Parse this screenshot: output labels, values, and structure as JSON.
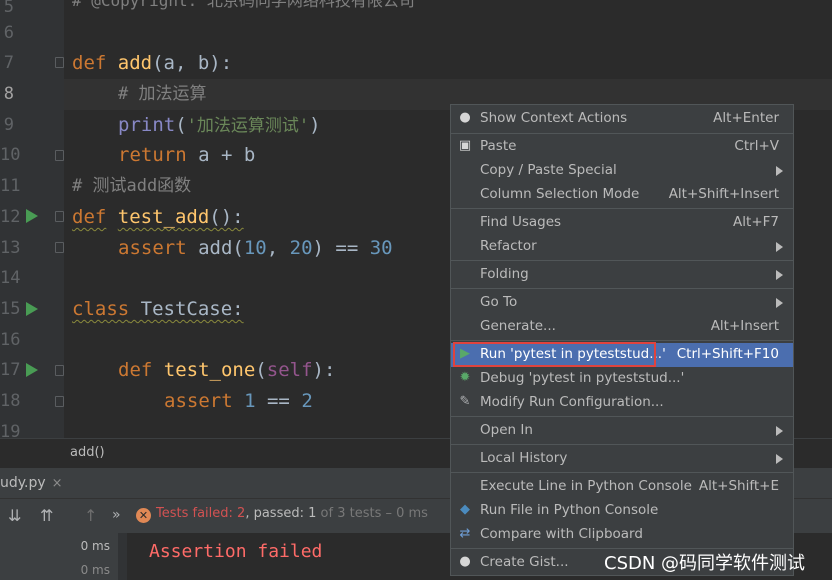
{
  "editor": {
    "line_numbers": [
      "5",
      "6",
      "7",
      "8",
      "9",
      "10",
      "11",
      "12",
      "13",
      "14",
      "15",
      "16",
      "17",
      "18",
      "19"
    ],
    "line5_comment": "# @Copyright: 北京码同学网络科技有限公司",
    "def_kw": "def",
    "add_fn": "add",
    "add_params": "(a, b):",
    "comment_add": "# 加法运算",
    "print_fn": "print",
    "print_str": "'加法运算测试'",
    "return_kw": "return",
    "return_expr": " a + b",
    "comment_test": "# 测试add函数",
    "test_add_fn": "test_add",
    "empty_parens": "():",
    "assert_kw": "assert",
    "assert_call": " add(",
    "num_10": "10",
    "comma": ", ",
    "num_20": "20",
    "eq_part": ") == ",
    "num_30": "30",
    "class_kw": "class",
    "class_name": " TestCase:",
    "test_one_fn": "test_one",
    "self_kw": "self",
    "num_1": "1",
    "eq2": " == ",
    "num_2": "2"
  },
  "breadcrumb": "add()",
  "run_panel": {
    "tab_label": "udy.py",
    "tab_close": "×",
    "status_fail_prefix": "Tests failed: ",
    "status_fail_count": "2",
    "status_pass_prefix": ", passed: ",
    "status_pass_count": "1",
    "status_total": " of 3 tests – 0 ms",
    "tree_times": [
      "0 ms",
      "0 ms"
    ],
    "console_text": "Assertion failed"
  },
  "context_menu": {
    "items": [
      {
        "label": "Show Context Actions",
        "shortcut": "Alt+Enter",
        "icon": "lightbulb-icon"
      },
      {
        "label": "Paste",
        "shortcut": "Ctrl+V",
        "icon": "clipboard-icon"
      },
      {
        "label": "Copy / Paste Special",
        "submenu": true
      },
      {
        "label": "Column Selection Mode",
        "shortcut": "Alt+Shift+Insert"
      },
      {
        "label": "Find Usages",
        "shortcut": "Alt+F7"
      },
      {
        "label": "Refactor",
        "submenu": true
      },
      {
        "label": "Folding",
        "submenu": true
      },
      {
        "label": "Go To",
        "submenu": true
      },
      {
        "label": "Generate...",
        "shortcut": "Alt+Insert"
      },
      {
        "label": "Run 'pytest in pyteststud...'",
        "shortcut": "Ctrl+Shift+F10",
        "icon": "run-icon",
        "selected": true
      },
      {
        "label": "Debug 'pytest in pyteststud...'",
        "icon": "debug-icon"
      },
      {
        "label": "Modify Run Configuration...",
        "icon": "wrench-icon"
      },
      {
        "label": "Open In",
        "submenu": true
      },
      {
        "label": "Local History",
        "submenu": true
      },
      {
        "label": "Execute Line in Python Console",
        "shortcut": "Alt+Shift+E"
      },
      {
        "label": "Run File in Python Console",
        "icon": "python-icon"
      },
      {
        "label": "Compare with Clipboard",
        "icon": "compare-icon"
      },
      {
        "label": "Create Gist...",
        "icon": "github-icon"
      }
    ]
  },
  "colors": {
    "selection": "#4b6eaf",
    "highlight_box": "#e0433e",
    "run_green": "#499c54"
  },
  "watermark": "CSDN @码同学软件测试"
}
